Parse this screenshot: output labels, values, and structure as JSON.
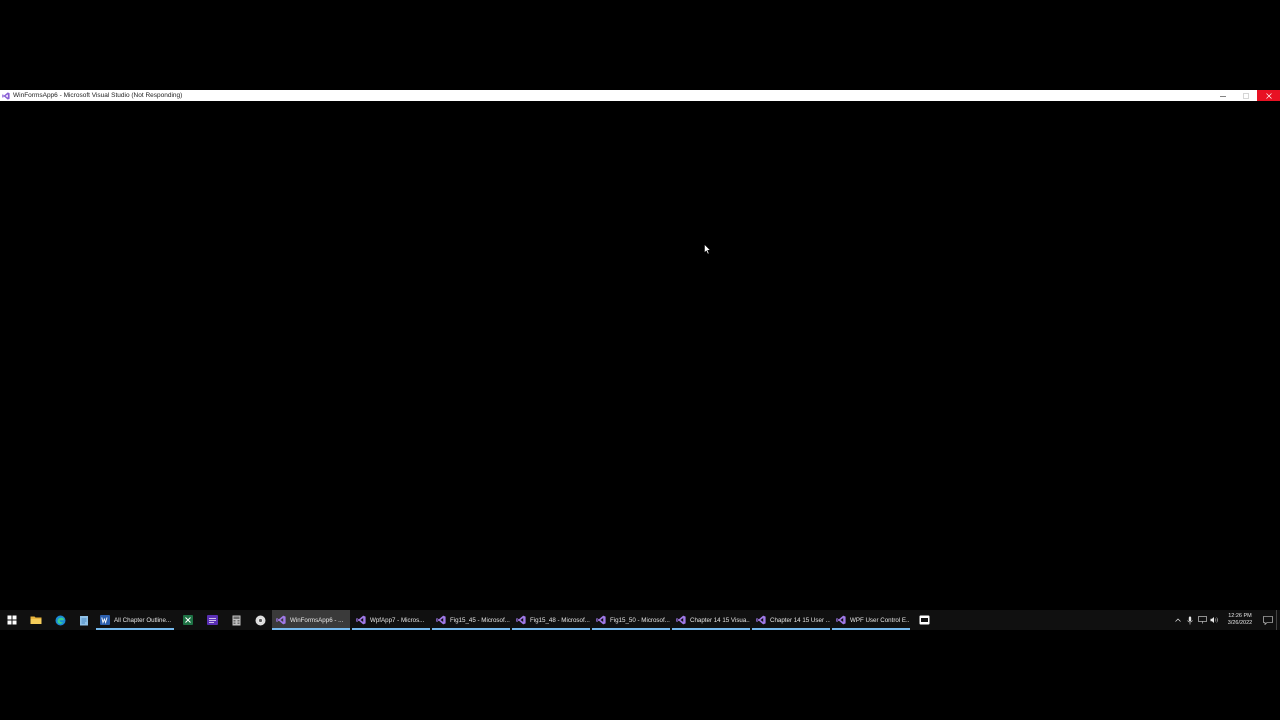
{
  "window": {
    "title": "WinFormsApp6 - Microsoft Visual Studio (Not Responding)",
    "controls": {
      "minimize_icon": "minimize-icon",
      "maximize_icon": "maximize-icon",
      "close_icon": "close-icon"
    }
  },
  "taskbar": {
    "pinned": [
      {
        "name": "start",
        "icon": "windows-start-icon"
      },
      {
        "name": "file-explorer",
        "icon": "folder-icon"
      },
      {
        "name": "edge",
        "icon": "edge-icon"
      },
      {
        "name": "notepad",
        "icon": "notepad-icon"
      }
    ],
    "word_app": {
      "label": "All Chapter Outline...",
      "icon": "word-icon"
    },
    "pinned_after_word": [
      {
        "name": "excel",
        "icon": "excel-icon"
      },
      {
        "name": "visual-studio-pinned",
        "icon": "visual-studio-icon"
      },
      {
        "name": "calculator",
        "icon": "calculator-icon"
      },
      {
        "name": "chrome",
        "icon": "chrome-icon"
      }
    ],
    "apps": [
      {
        "label": "WinFormsApp6 - ...",
        "icon": "visual-studio-icon",
        "active": true
      },
      {
        "label": "WpfApp7 - Micros...",
        "icon": "visual-studio-icon",
        "active": false
      },
      {
        "label": "Fig15_45 - Microsof...",
        "icon": "visual-studio-icon",
        "active": false
      },
      {
        "label": "Fig15_48 - Microsof...",
        "icon": "visual-studio-icon",
        "active": false
      },
      {
        "label": "Fig15_50 - Microsof...",
        "icon": "visual-studio-icon",
        "active": false
      },
      {
        "label": "Chapter 14 15 Visua...",
        "icon": "visual-studio-icon",
        "active": false
      },
      {
        "label": "Chapter 14 15 User ...",
        "icon": "visual-studio-icon",
        "active": false
      },
      {
        "label": "WPF User Control E...",
        "icon": "visual-studio-icon",
        "active": false
      }
    ],
    "trailing_app_icon": "screen-recorder-icon",
    "tray": {
      "icons": [
        "chevron-up-icon",
        "microphone-icon",
        "network-icon",
        "volume-icon"
      ],
      "time": "12:26 PM",
      "date": "3/26/2022",
      "notification_icon": "notification-icon"
    }
  },
  "colors": {
    "close_button": "#e81123",
    "taskbar_bg": "#101010",
    "active_underline": "#76b9ed",
    "vs_purple": "#8a5fd6"
  }
}
